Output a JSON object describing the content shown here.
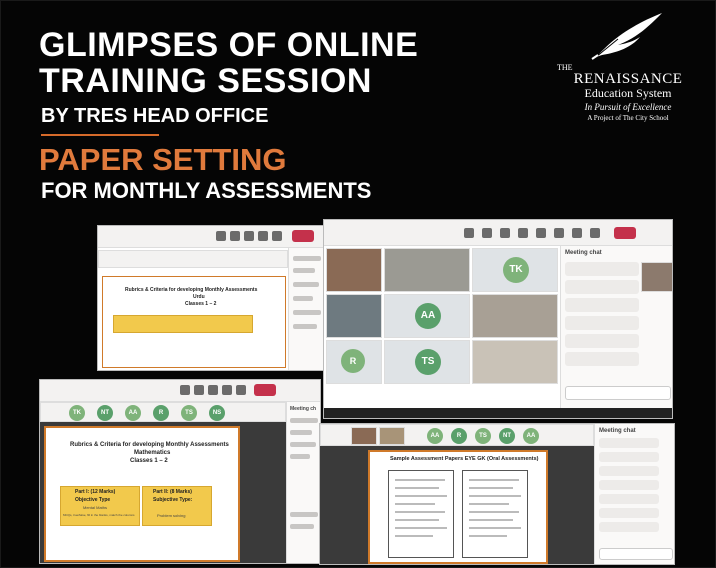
{
  "headline": {
    "line1": "GLIMPSES OF ONLINE",
    "line2": "TRAINING SESSION",
    "byline": "BY TRES HEAD OFFICE",
    "topic": "PAPER SETTING",
    "subtopic": "FOR MONTHLY ASSESSMENTS"
  },
  "logo": {
    "the": "THE",
    "name": "RENAISSANCE",
    "system": "Education System",
    "tagline": "In Pursuit of Excellence",
    "project": "A Project of The City School"
  },
  "screens": {
    "s1": {
      "slide_title": "Rubrics & Criteria for developing Monthly Assessments",
      "slide_subtitle": "Urdu",
      "slide_classes": "Classes 1 – 2"
    },
    "s2": {
      "avatars": [
        "TK",
        "AA",
        "R",
        "TS"
      ],
      "chat_title": "Meeting chat"
    },
    "s3": {
      "avatars": [
        "TK",
        "NT",
        "AA",
        "R",
        "TS",
        "NS"
      ],
      "chat_title": "Meeting ch",
      "slide_title": "Rubrics & Criteria for developing Monthly Assessments",
      "slide_subject": "Mathematics",
      "slide_classes": "Classes 1 – 2",
      "part1_title": "Part I: (12 Marks)",
      "part1_type": "Objective Type",
      "part1_sub": "Mental Maths",
      "part1_desc": "MCQs, true/false, fill in the blanks, match the columns",
      "part2_title": "Part II: (8 Marks)",
      "part2_type": "Subjective Type:",
      "part2_desc": "Problem solving"
    },
    "s4": {
      "avatars": [
        "AA",
        "R",
        "TS",
        "NT",
        "AA"
      ],
      "chat_title": "Meeting chat",
      "slide_title": "Sample Assessment Papers EYE GK (Oral Assessments)"
    }
  }
}
